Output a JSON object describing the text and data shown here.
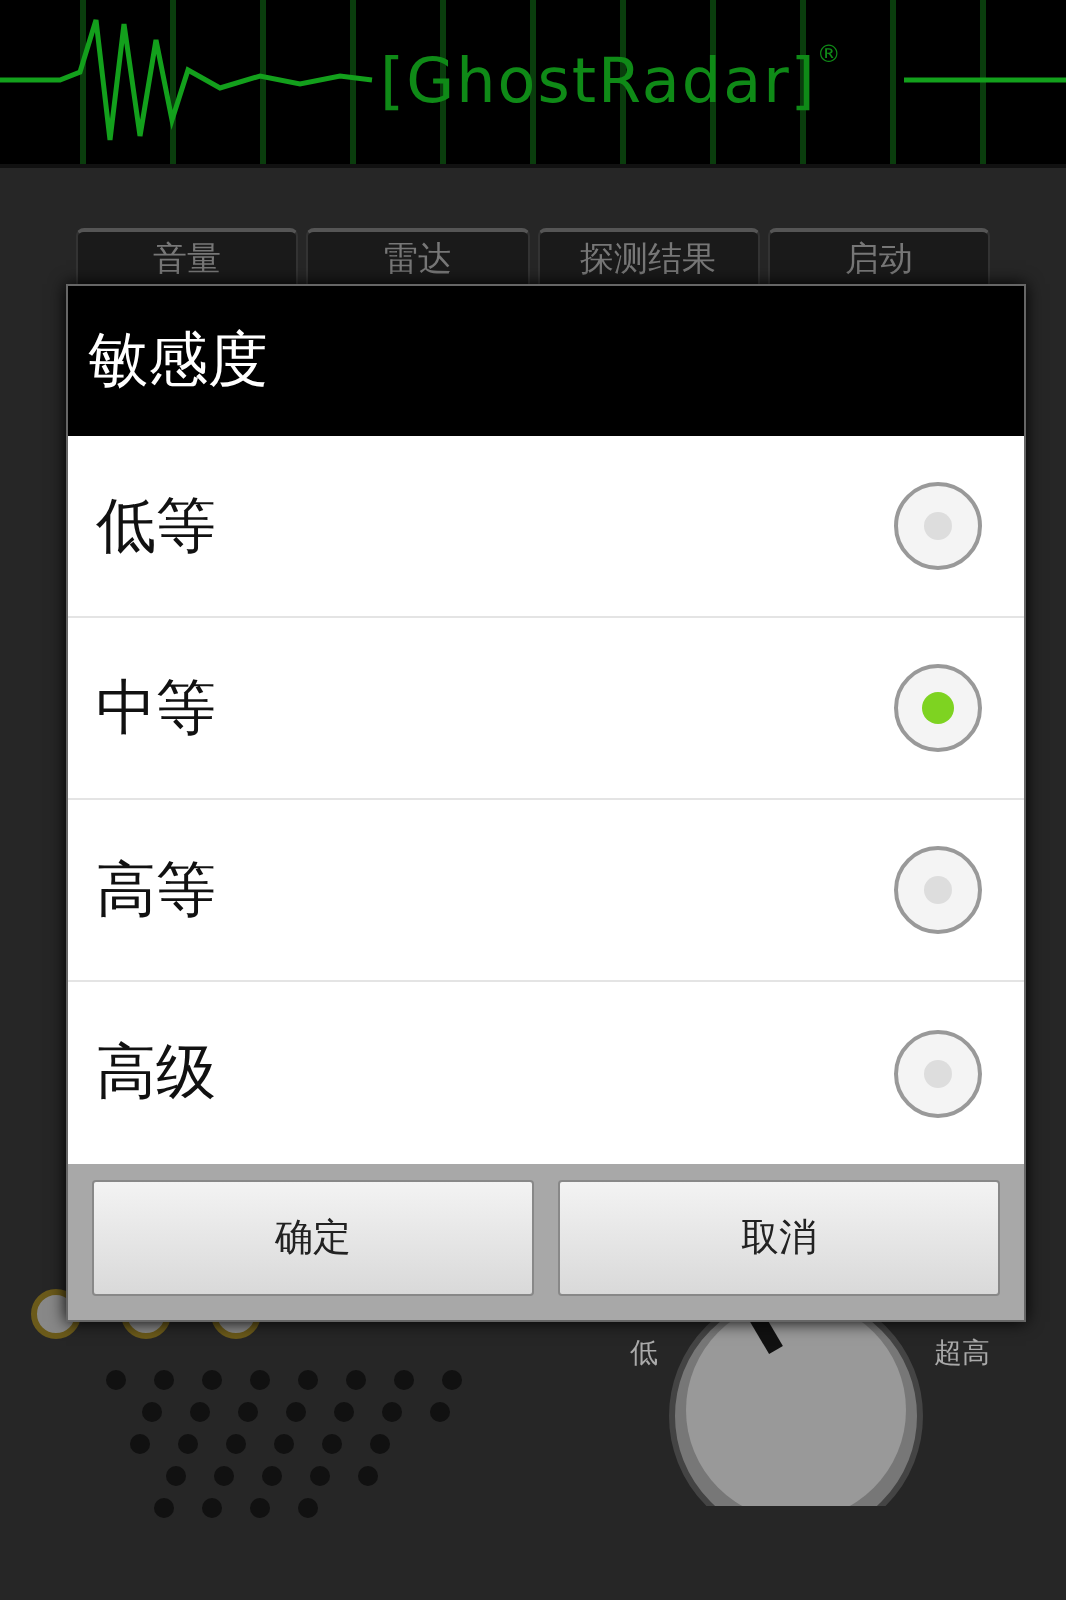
{
  "header": {
    "logo": "[GhostRadar]",
    "registered": "®"
  },
  "tabs": [
    {
      "label": "音量"
    },
    {
      "label": "雷达"
    },
    {
      "label": "探测结果"
    },
    {
      "label": "启动"
    }
  ],
  "knob": {
    "low_label": "低",
    "high_label": "超高"
  },
  "dialog": {
    "title": "敏感度",
    "options": [
      {
        "label": "低等",
        "selected": false
      },
      {
        "label": "中等",
        "selected": true
      },
      {
        "label": "高等",
        "selected": false
      },
      {
        "label": "高级",
        "selected": false
      }
    ],
    "buttons": [
      "确定",
      "取消"
    ]
  }
}
